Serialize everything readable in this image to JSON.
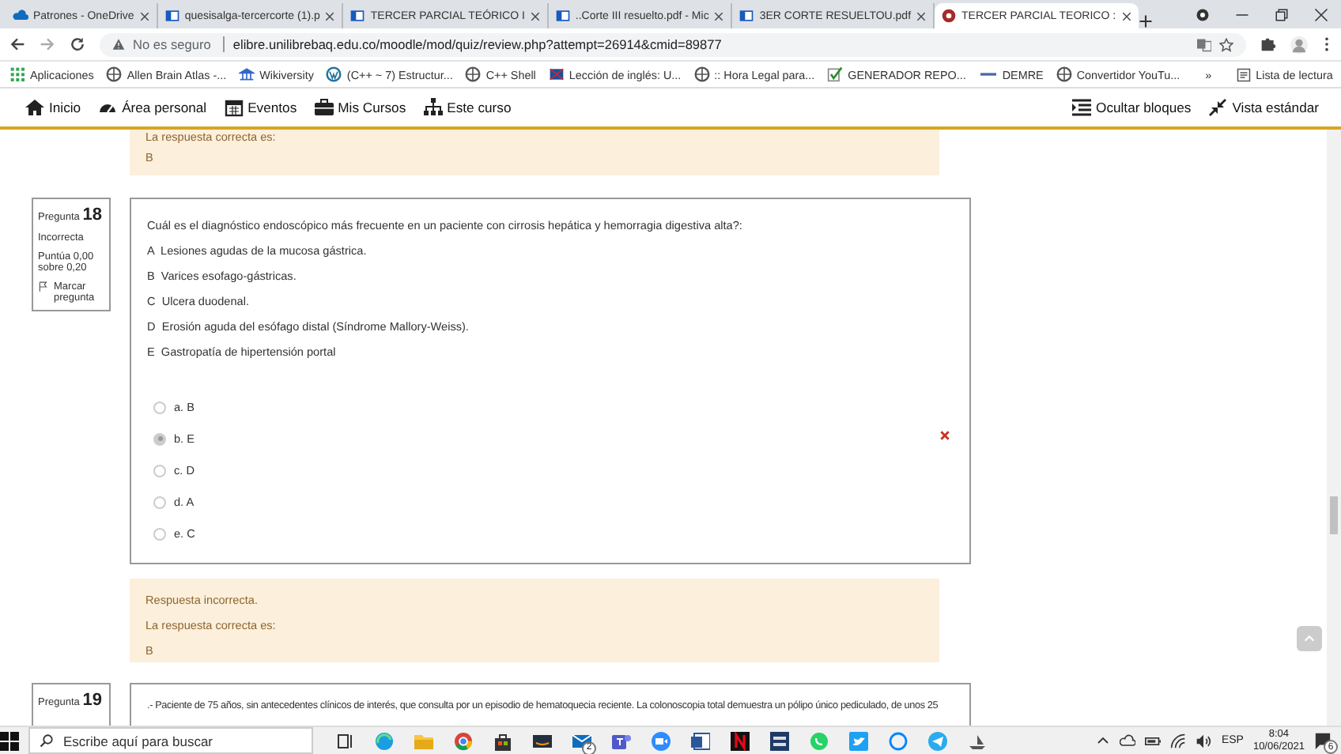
{
  "browser": {
    "tabs": [
      {
        "title": "Patrones - OneDrive",
        "kind": "cloud",
        "selected": false
      },
      {
        "title": "quesisalga-tercercorte (1).p",
        "kind": "doc",
        "selected": false
      },
      {
        "title": "TERCER PARCIAL TEÓRICO I",
        "kind": "doc",
        "selected": false
      },
      {
        "title": "..Corte III resuelto.pdf - Mic",
        "kind": "doc",
        "selected": false
      },
      {
        "title": "3ER CORTE RESUELTOU.pdf",
        "kind": "doc",
        "selected": false
      },
      {
        "title": "TERCER PARCIAL TEORICO :",
        "kind": "site",
        "selected": true
      }
    ],
    "security": "No es seguro",
    "url": "elibre.unilibrebaq.edu.co/moodle/mod/quiz/review.php?attempt=26914&cmid=89877",
    "bookmarks": [
      {
        "label": "Aplicaciones",
        "kind": "apps"
      },
      {
        "label": "Allen Brain Atlas -...",
        "kind": "globe"
      },
      {
        "label": "Wikiversity",
        "kind": "wiki"
      },
      {
        "label": "(C++ ~ 7) Estructur...",
        "kind": "wp"
      },
      {
        "label": "C++ Shell",
        "kind": "globe"
      },
      {
        "label": "Lección de inglés: U...",
        "kind": "flag"
      },
      {
        "label": ":: Hora Legal para...",
        "kind": "globe"
      },
      {
        "label": "GENERADOR REPO...",
        "kind": "check"
      },
      {
        "label": "DEMRE",
        "kind": "bar"
      },
      {
        "label": "Convertidor YouTu...",
        "kind": "globe"
      }
    ],
    "more": "»",
    "reading_list": "Lista de lectura"
  },
  "nav": {
    "items": [
      {
        "label": "Inicio",
        "kind": "home"
      },
      {
        "label": "Área personal",
        "kind": "gauge"
      },
      {
        "label": "Eventos",
        "kind": "calendar"
      },
      {
        "label": "Mis Cursos",
        "kind": "briefcase"
      },
      {
        "label": "Este curso",
        "kind": "sitemap"
      }
    ],
    "right": [
      {
        "label": "Ocultar bloques",
        "kind": "blocks"
      },
      {
        "label": "Vista estándar",
        "kind": "compress"
      }
    ]
  },
  "previous_feedback": {
    "label": "La respuesta correcta es:",
    "answer": "B"
  },
  "question": {
    "label": "Pregunta",
    "number": "18",
    "state": "Incorrecta",
    "grade": "Puntúa 0,00 sobre 0,20",
    "flag": "Marcar pregunta",
    "text": "Cuál es el diagnóstico endoscópico más frecuente en un paciente con cirrosis hepática y hemorragia digestiva alta?:",
    "lines": [
      "A  Lesiones agudas de la mucosa gástrica.",
      "B  Varices esofago-gástricas.",
      "C  Ulcera duodenal.",
      "D  Erosión aguda del esófago distal (Síndrome Mallory-Weiss).",
      "E  Gastropatía de hipertensión portal"
    ],
    "options": [
      {
        "label": "a. B",
        "selected": false
      },
      {
        "label": "b. E",
        "selected": true
      },
      {
        "label": "c. D",
        "selected": false
      },
      {
        "label": "d. A",
        "selected": false
      },
      {
        "label": "e. C",
        "selected": false
      }
    ],
    "feedback": {
      "result": "Respuesta incorrecta.",
      "label": "La respuesta correcta es:",
      "answer": "B"
    }
  },
  "next_question": {
    "label": "Pregunta",
    "number": "19",
    "text": ".- Paciente de 75 años, sin antecedentes clínicos de interés, que consulta por un episodio de hematoquecia reciente. La colonoscopia total demuestra un pólipo único pediculado, de unos 25"
  },
  "taskbar": {
    "search_placeholder": "Escribe aquí para buscar",
    "mail_badge": "2",
    "language": "ESP",
    "time": "8:04",
    "date": "10/06/2021",
    "notifications": "6"
  }
}
